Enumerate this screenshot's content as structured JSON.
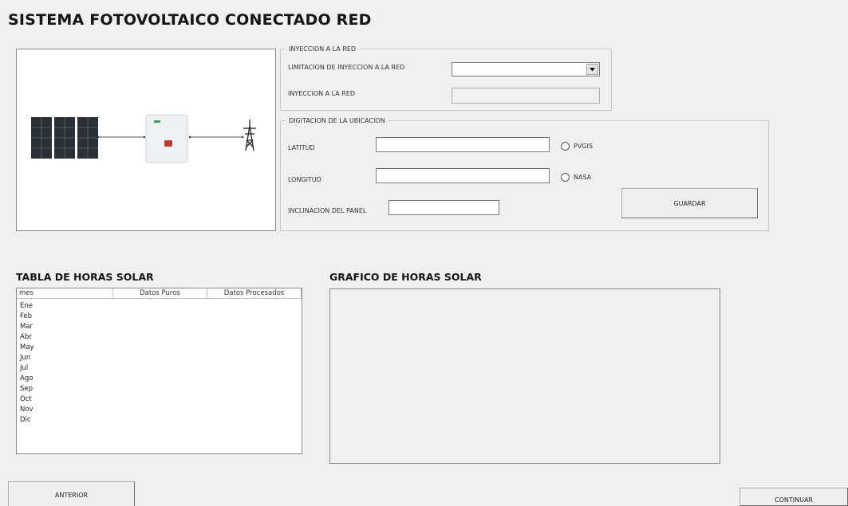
{
  "page": {
    "title": "SISTEMA FOTOVOLTAICO CONECTADO RED"
  },
  "injection": {
    "legend": "INYECCION A LA RED",
    "limit_label": "LIMITACION DE INYECCION A LA RED",
    "limit_value": "",
    "injection_label": "INYECCION A LA RED",
    "injection_value": ""
  },
  "location": {
    "legend": "DIGITACION DE LA UBICACION",
    "latitude_label": "LATITUD",
    "latitude_value": "",
    "longitude_label": "LONGITUD",
    "longitude_value": "",
    "tilt_label": "INCLINACION DEL PANEL",
    "tilt_value": "",
    "radio_pvgis": "PVGIS",
    "radio_nasa": "NASA",
    "save_label": "GUARDAR"
  },
  "table": {
    "title": "TABLA DE HORAS SOLAR",
    "columns": [
      "mes",
      "Datos Puros",
      "Datos Procesados"
    ],
    "rows": [
      {
        "mes": "Ene"
      },
      {
        "mes": "Feb"
      },
      {
        "mes": "Mar"
      },
      {
        "mes": "Abr"
      },
      {
        "mes": "May"
      },
      {
        "mes": "Jun"
      },
      {
        "mes": "Jul"
      },
      {
        "mes": "Ago"
      },
      {
        "mes": "Sep"
      },
      {
        "mes": "Oct"
      },
      {
        "mes": "Nov"
      },
      {
        "mes": "Dic"
      }
    ]
  },
  "chart": {
    "title": "GRAFICO DE HORAS SOLAR"
  },
  "nav": {
    "back_label": "ANTERIOR",
    "next_label": "CONTINUAR"
  },
  "diagram": {
    "icons": [
      "solar-panel-icon",
      "inverter-icon",
      "transmission-tower-icon"
    ],
    "colors": {
      "panel": "#2b2f36",
      "inverter_led": "#c23a2a",
      "inverter_badge": "#3aa35a"
    }
  }
}
